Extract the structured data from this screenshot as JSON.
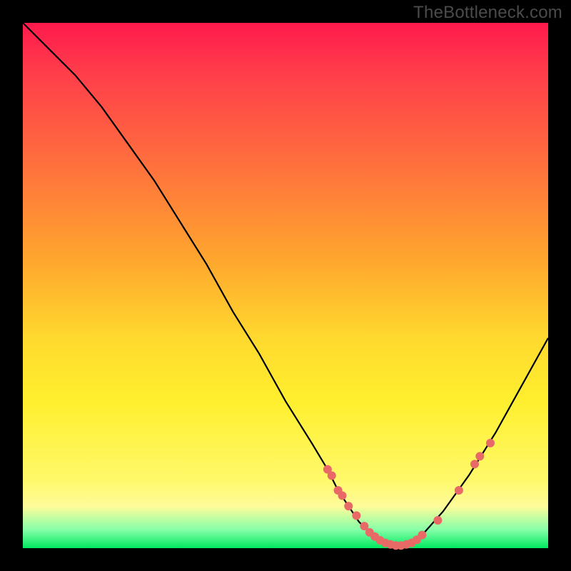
{
  "watermark": "TheBottleneck.com",
  "colors": {
    "background": "#000000",
    "gradient_top": "#ff1a4d",
    "gradient_bottom": "#00e85f",
    "curve": "#000000",
    "marker": "#e86a67"
  },
  "chart_data": {
    "type": "line",
    "title": "",
    "xlabel": "",
    "ylabel": "",
    "xlim": [
      0,
      100
    ],
    "ylim": [
      0,
      100
    ],
    "grid": false,
    "legend": false,
    "series": [
      {
        "name": "bottleneck-curve",
        "x": [
          0,
          5,
          10,
          15,
          20,
          25,
          30,
          35,
          40,
          45,
          50,
          55,
          58,
          60,
          62,
          64,
          66,
          68,
          70,
          72,
          74,
          76,
          80,
          85,
          90,
          95,
          100
        ],
        "values": [
          100,
          95,
          90,
          84,
          77,
          70,
          62,
          54,
          45,
          37,
          28,
          20,
          15,
          11,
          8,
          5,
          3,
          1.5,
          0.7,
          0.5,
          1,
          2.5,
          7,
          14,
          22,
          31,
          40
        ]
      }
    ],
    "markers": {
      "name": "highlight-points",
      "x": [
        58,
        58.8,
        60,
        60.8,
        62,
        63.5,
        65,
        66,
        67,
        68,
        69,
        70,
        71,
        72,
        73,
        74,
        75,
        76,
        79,
        83,
        86,
        87,
        89
      ],
      "values": [
        15,
        13.8,
        11,
        10,
        8,
        6.2,
        4.2,
        3.0,
        2.2,
        1.5,
        1.0,
        0.7,
        0.5,
        0.5,
        0.7,
        1.0,
        1.6,
        2.5,
        5.3,
        11,
        16,
        17.5,
        20
      ]
    }
  }
}
